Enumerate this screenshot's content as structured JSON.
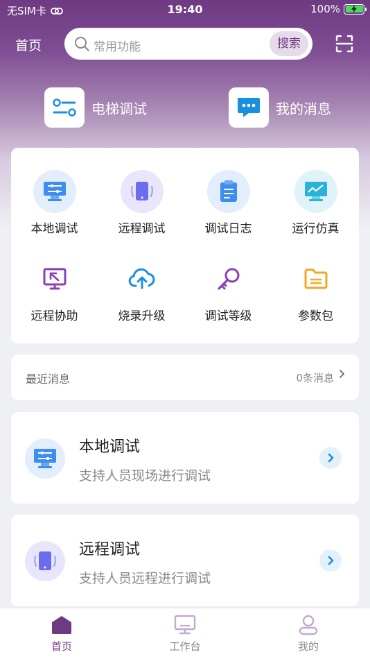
{
  "status_bar": {
    "carrier": "无SIM卡",
    "time": "19:40",
    "battery": "100%"
  },
  "header": {
    "title": "首页",
    "search_placeholder": "常用功能",
    "search_button": "搜索",
    "scan_icon": "scan-icon"
  },
  "quick_links": [
    {
      "label": "电梯调试",
      "icon": "toggle-sliders-icon"
    },
    {
      "label": "我的消息",
      "icon": "message-bubble-icon"
    }
  ],
  "functions": [
    {
      "label": "本地调试",
      "icon": "local-monitor-icon"
    },
    {
      "label": "远程调试",
      "icon": "remote-tablet-icon"
    },
    {
      "label": "调试日志",
      "icon": "log-clipboard-icon"
    },
    {
      "label": "运行仿真",
      "icon": "simulation-chart-icon"
    },
    {
      "label": "远程协助",
      "icon": "remote-assist-icon"
    },
    {
      "label": "烧录升级",
      "icon": "cloud-upload-icon"
    },
    {
      "label": "调试等级",
      "icon": "key-icon"
    },
    {
      "label": "参数包",
      "icon": "folder-icon"
    }
  ],
  "recent": {
    "title": "最近消息",
    "count": "0条消息"
  },
  "features": [
    {
      "title": "本地调试",
      "desc": "支持人员现场进行调试"
    },
    {
      "title": "远程调试",
      "desc": "支持人员远程进行调试"
    }
  ],
  "tabs": [
    {
      "label": "首页",
      "active": true
    },
    {
      "label": "工作台",
      "active": false
    },
    {
      "label": "我的",
      "active": false
    }
  ],
  "colors": {
    "brand_purple": "#6e3a82",
    "tab_active": "#6e3a82",
    "tab_inactive": "#888888",
    "chevron_blue": "#1a8fe0"
  }
}
